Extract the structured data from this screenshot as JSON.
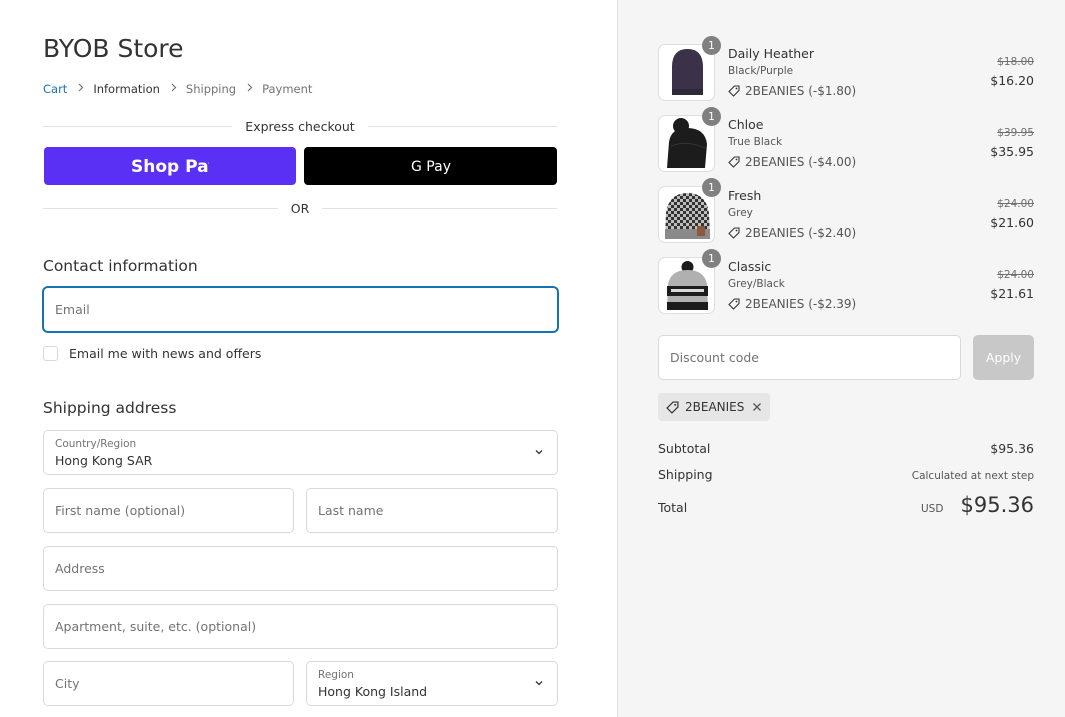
{
  "store": {
    "title": "BYOB Store"
  },
  "breadcrumb": {
    "cart": "Cart",
    "information": "Information",
    "shipping": "Shipping",
    "payment": "Payment"
  },
  "express": {
    "label": "Express checkout",
    "shop_pay": "Shop Pay",
    "google_pay": "G Pay",
    "or": "OR"
  },
  "contact": {
    "heading": "Contact information",
    "email_placeholder": "Email",
    "newsletter_label": "Email me with news and offers"
  },
  "shipping_address": {
    "heading": "Shipping address",
    "country_label": "Country/Region",
    "country_value": "Hong Kong SAR",
    "first_name_placeholder": "First name (optional)",
    "last_name_placeholder": "Last name",
    "address_placeholder": "Address",
    "apartment_placeholder": "Apartment, suite, etc. (optional)",
    "city_placeholder": "City",
    "region_label": "Region",
    "region_value": "Hong Kong Island"
  },
  "cart_items": [
    {
      "name": "Daily Heather",
      "variant": "Black/Purple",
      "discount": "2BEANIES (-$1.80)",
      "old_price": "$18.00",
      "price": "$16.20",
      "qty": "1",
      "thumb_color": "#3b3148"
    },
    {
      "name": "Chloe",
      "variant": "True Black",
      "discount": "2BEANIES (-$4.00)",
      "old_price": "$39.95",
      "price": "$35.95",
      "qty": "1",
      "thumb_color": "#1c1c1c"
    },
    {
      "name": "Fresh",
      "variant": "Grey",
      "discount": "2BEANIES (-$2.40)",
      "old_price": "$24.00",
      "price": "$21.60",
      "qty": "1",
      "thumb_color": "#8a8a8a"
    },
    {
      "name": "Classic",
      "variant": "Grey/Black",
      "discount": "2BEANIES (-$2.39)",
      "old_price": "$24.00",
      "price": "$21.61",
      "qty": "1",
      "thumb_color": "#a9a9a9"
    }
  ],
  "discount": {
    "placeholder": "Discount code",
    "apply_label": "Apply",
    "applied_code": "2BEANIES"
  },
  "summary": {
    "subtotal_label": "Subtotal",
    "subtotal_value": "$95.36",
    "shipping_label": "Shipping",
    "shipping_value": "Calculated at next step",
    "total_label": "Total",
    "total_currency": "USD",
    "total_value": "$95.36"
  },
  "colors": {
    "accent": "#1773b0",
    "shop_pay": "#5a31f4",
    "google_pay": "#000000",
    "apply_disabled": "#c8c8c8"
  }
}
